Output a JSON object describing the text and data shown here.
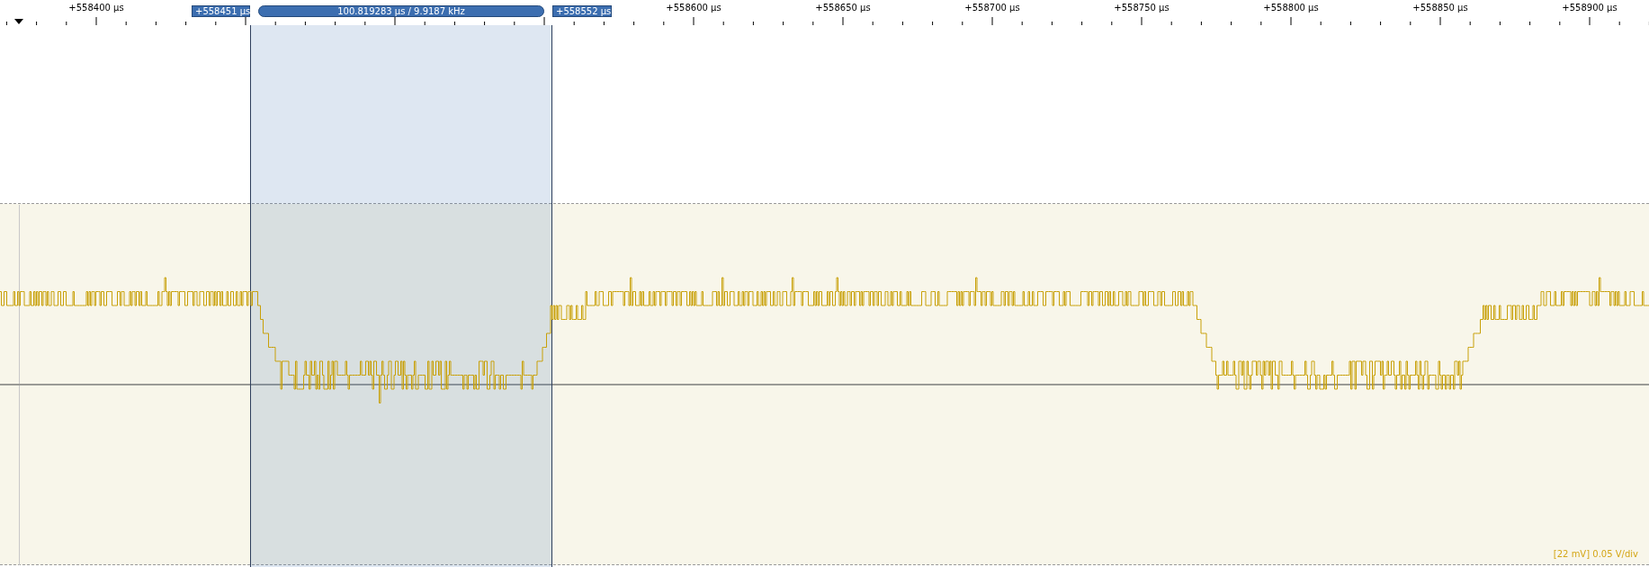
{
  "ruler": {
    "labels": [
      "+558400 µs",
      "+558600 µs",
      "+558650 µs",
      "+558700 µs",
      "+558750 µs",
      "+558800 µs",
      "+558850 µs",
      "+558900 µs"
    ]
  },
  "cursors": [
    {
      "label": "+558451 µs"
    },
    {
      "label": "+558552 µs"
    }
  ],
  "measurement": "100.819283 µs / 9.9187 kHz",
  "channel": {
    "scale": "[22 mV] 0.05 V/div"
  }
}
